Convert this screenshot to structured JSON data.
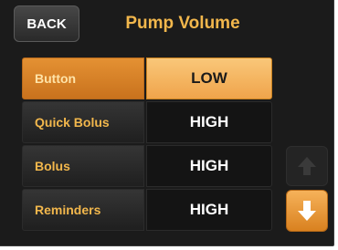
{
  "header": {
    "back_label": "BACK",
    "title": "Pump Volume"
  },
  "settings": [
    {
      "label": "Button",
      "value": "LOW",
      "selected": true
    },
    {
      "label": "Quick Bolus",
      "value": "HIGH",
      "selected": false
    },
    {
      "label": "Bolus",
      "value": "HIGH",
      "selected": false
    },
    {
      "label": "Reminders",
      "value": "HIGH",
      "selected": false
    }
  ],
  "scroll": {
    "up_icon": "arrow-up-icon",
    "up_enabled": false,
    "down_icon": "arrow-down-icon",
    "down_enabled": true
  },
  "colors": {
    "accent_orange": "#f2b74c",
    "selected_value_bg": "#f9c779",
    "background": "#1b1b1b"
  }
}
